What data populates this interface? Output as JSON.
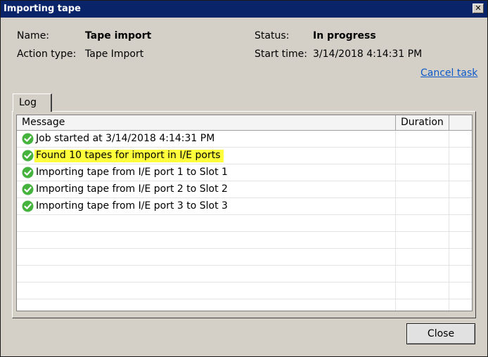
{
  "window": {
    "title": "Importing tape",
    "close_glyph": "✕"
  },
  "info": {
    "name_label": "Name:",
    "name_value": "Tape import",
    "action_type_label": "Action type:",
    "action_type_value": "Tape Import",
    "status_label": "Status:",
    "status_value": "In progress",
    "start_time_label": "Start time:",
    "start_time_value": "3/14/2018 4:14:31 PM"
  },
  "cancel_task_label": "Cancel task",
  "tabs": [
    {
      "label": "Log",
      "active": true
    }
  ],
  "log": {
    "columns": [
      "Message",
      "Duration"
    ],
    "rows": [
      {
        "icon": "check-success-icon",
        "message": "Job started at 3/14/2018 4:14:31 PM",
        "duration": "",
        "highlighted": false
      },
      {
        "icon": "check-success-icon",
        "message": "Found 10 tapes for import in I/E ports",
        "duration": "",
        "highlighted": true
      },
      {
        "icon": "check-success-icon",
        "message": "Importing tape from I/E port 1 to Slot 1",
        "duration": "",
        "highlighted": false
      },
      {
        "icon": "check-success-icon",
        "message": "Importing tape from I/E port 2 to Slot 2",
        "duration": "",
        "highlighted": false
      },
      {
        "icon": "check-success-icon",
        "message": "Importing tape from I/E port 3 to Slot 3",
        "duration": "",
        "highlighted": false
      }
    ]
  },
  "buttons": {
    "close_label": "Close"
  },
  "colors": {
    "titlebar": "#0a246a",
    "success_icon": "#46b33e",
    "highlight": "#ffff3c",
    "link": "#0b59c9"
  }
}
